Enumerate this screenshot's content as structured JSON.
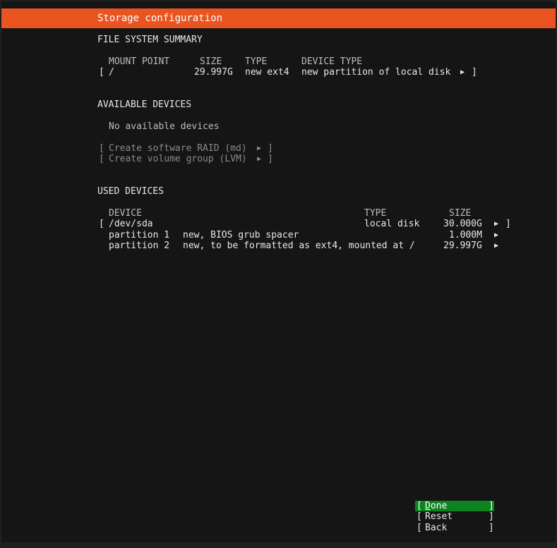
{
  "header": {
    "title": "Storage configuration"
  },
  "fs_summary": {
    "heading": "FILE SYSTEM SUMMARY",
    "columns": [
      "MOUNT POINT",
      "SIZE",
      "TYPE",
      "DEVICE TYPE"
    ],
    "rows": [
      {
        "mount": "/",
        "size": "29.997G",
        "type": "new ext4",
        "device_type": "new partition of local disk"
      }
    ]
  },
  "available": {
    "heading": "AVAILABLE DEVICES",
    "empty_text": "No available devices",
    "raid_label": "Create software RAID (md)",
    "lvm_label": "Create volume group (LVM)"
  },
  "used": {
    "heading": "USED DEVICES",
    "columns": [
      "DEVICE",
      "TYPE",
      "SIZE"
    ],
    "disk": {
      "device": "/dev/sda",
      "type": "local disk",
      "size": "30.000G"
    },
    "partitions": [
      {
        "name": "partition 1",
        "desc": "new, BIOS grub spacer",
        "size": "1.000M"
      },
      {
        "name": "partition 2",
        "desc": "new, to be formatted as ext4, mounted at /",
        "size": "29.997G"
      }
    ]
  },
  "glyphs": {
    "open_bracket": "[",
    "close_bracket": "]",
    "arrow": "▶"
  },
  "buttons": {
    "done": {
      "hotkey": "D",
      "rest": "one"
    },
    "reset": "Reset",
    "back": "Back"
  },
  "colors": {
    "title_bar": "#e95420",
    "focus": "#0e8420",
    "background": "#151515"
  }
}
